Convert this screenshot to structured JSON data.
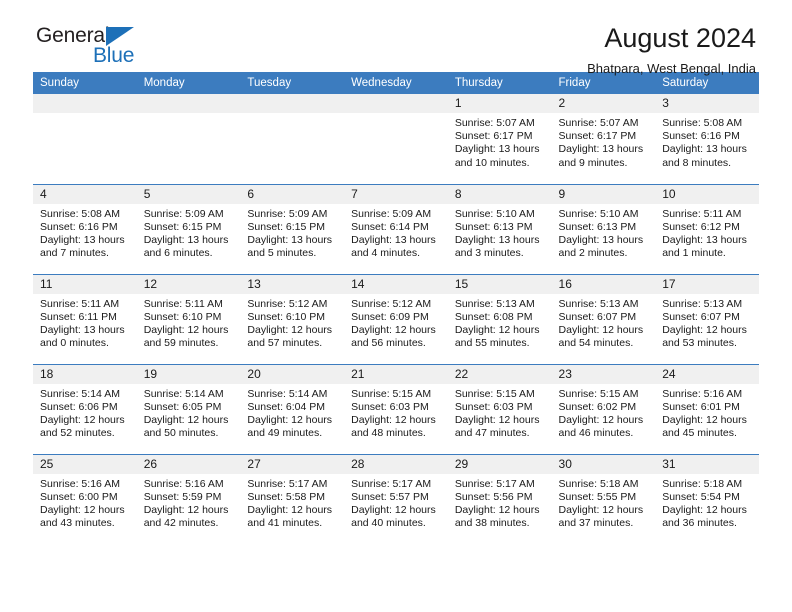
{
  "brand": {
    "word_one": "General",
    "word_two": "Blue",
    "flag_icon": "blue-triangle-flag",
    "accent_color": "#1d70b8"
  },
  "header": {
    "title": "August 2024",
    "subtitle": "Bhatpara, West Bengal, India"
  },
  "calendar": {
    "header_bg": "#3c7cbf",
    "daynum_bg": "#f0f0f0",
    "weekdays": [
      "Sunday",
      "Monday",
      "Tuesday",
      "Wednesday",
      "Thursday",
      "Friday",
      "Saturday"
    ],
    "labels": {
      "sunrise": "Sunrise:",
      "sunset": "Sunset:",
      "daylight": "Daylight:"
    },
    "weeks": [
      [
        {
          "day": "",
          "sunrise": "",
          "sunset": "",
          "daylight": ""
        },
        {
          "day": "",
          "sunrise": "",
          "sunset": "",
          "daylight": ""
        },
        {
          "day": "",
          "sunrise": "",
          "sunset": "",
          "daylight": ""
        },
        {
          "day": "",
          "sunrise": "",
          "sunset": "",
          "daylight": ""
        },
        {
          "day": "1",
          "sunrise": "Sunrise: 5:07 AM",
          "sunset": "Sunset: 6:17 PM",
          "daylight": "Daylight: 13 hours and 10 minutes."
        },
        {
          "day": "2",
          "sunrise": "Sunrise: 5:07 AM",
          "sunset": "Sunset: 6:17 PM",
          "daylight": "Daylight: 13 hours and 9 minutes."
        },
        {
          "day": "3",
          "sunrise": "Sunrise: 5:08 AM",
          "sunset": "Sunset: 6:16 PM",
          "daylight": "Daylight: 13 hours and 8 minutes."
        }
      ],
      [
        {
          "day": "4",
          "sunrise": "Sunrise: 5:08 AM",
          "sunset": "Sunset: 6:16 PM",
          "daylight": "Daylight: 13 hours and 7 minutes."
        },
        {
          "day": "5",
          "sunrise": "Sunrise: 5:09 AM",
          "sunset": "Sunset: 6:15 PM",
          "daylight": "Daylight: 13 hours and 6 minutes."
        },
        {
          "day": "6",
          "sunrise": "Sunrise: 5:09 AM",
          "sunset": "Sunset: 6:15 PM",
          "daylight": "Daylight: 13 hours and 5 minutes."
        },
        {
          "day": "7",
          "sunrise": "Sunrise: 5:09 AM",
          "sunset": "Sunset: 6:14 PM",
          "daylight": "Daylight: 13 hours and 4 minutes."
        },
        {
          "day": "8",
          "sunrise": "Sunrise: 5:10 AM",
          "sunset": "Sunset: 6:13 PM",
          "daylight": "Daylight: 13 hours and 3 minutes."
        },
        {
          "day": "9",
          "sunrise": "Sunrise: 5:10 AM",
          "sunset": "Sunset: 6:13 PM",
          "daylight": "Daylight: 13 hours and 2 minutes."
        },
        {
          "day": "10",
          "sunrise": "Sunrise: 5:11 AM",
          "sunset": "Sunset: 6:12 PM",
          "daylight": "Daylight: 13 hours and 1 minute."
        }
      ],
      [
        {
          "day": "11",
          "sunrise": "Sunrise: 5:11 AM",
          "sunset": "Sunset: 6:11 PM",
          "daylight": "Daylight: 13 hours and 0 minutes."
        },
        {
          "day": "12",
          "sunrise": "Sunrise: 5:11 AM",
          "sunset": "Sunset: 6:10 PM",
          "daylight": "Daylight: 12 hours and 59 minutes."
        },
        {
          "day": "13",
          "sunrise": "Sunrise: 5:12 AM",
          "sunset": "Sunset: 6:10 PM",
          "daylight": "Daylight: 12 hours and 57 minutes."
        },
        {
          "day": "14",
          "sunrise": "Sunrise: 5:12 AM",
          "sunset": "Sunset: 6:09 PM",
          "daylight": "Daylight: 12 hours and 56 minutes."
        },
        {
          "day": "15",
          "sunrise": "Sunrise: 5:13 AM",
          "sunset": "Sunset: 6:08 PM",
          "daylight": "Daylight: 12 hours and 55 minutes."
        },
        {
          "day": "16",
          "sunrise": "Sunrise: 5:13 AM",
          "sunset": "Sunset: 6:07 PM",
          "daylight": "Daylight: 12 hours and 54 minutes."
        },
        {
          "day": "17",
          "sunrise": "Sunrise: 5:13 AM",
          "sunset": "Sunset: 6:07 PM",
          "daylight": "Daylight: 12 hours and 53 minutes."
        }
      ],
      [
        {
          "day": "18",
          "sunrise": "Sunrise: 5:14 AM",
          "sunset": "Sunset: 6:06 PM",
          "daylight": "Daylight: 12 hours and 52 minutes."
        },
        {
          "day": "19",
          "sunrise": "Sunrise: 5:14 AM",
          "sunset": "Sunset: 6:05 PM",
          "daylight": "Daylight: 12 hours and 50 minutes."
        },
        {
          "day": "20",
          "sunrise": "Sunrise: 5:14 AM",
          "sunset": "Sunset: 6:04 PM",
          "daylight": "Daylight: 12 hours and 49 minutes."
        },
        {
          "day": "21",
          "sunrise": "Sunrise: 5:15 AM",
          "sunset": "Sunset: 6:03 PM",
          "daylight": "Daylight: 12 hours and 48 minutes."
        },
        {
          "day": "22",
          "sunrise": "Sunrise: 5:15 AM",
          "sunset": "Sunset: 6:03 PM",
          "daylight": "Daylight: 12 hours and 47 minutes."
        },
        {
          "day": "23",
          "sunrise": "Sunrise: 5:15 AM",
          "sunset": "Sunset: 6:02 PM",
          "daylight": "Daylight: 12 hours and 46 minutes."
        },
        {
          "day": "24",
          "sunrise": "Sunrise: 5:16 AM",
          "sunset": "Sunset: 6:01 PM",
          "daylight": "Daylight: 12 hours and 45 minutes."
        }
      ],
      [
        {
          "day": "25",
          "sunrise": "Sunrise: 5:16 AM",
          "sunset": "Sunset: 6:00 PM",
          "daylight": "Daylight: 12 hours and 43 minutes."
        },
        {
          "day": "26",
          "sunrise": "Sunrise: 5:16 AM",
          "sunset": "Sunset: 5:59 PM",
          "daylight": "Daylight: 12 hours and 42 minutes."
        },
        {
          "day": "27",
          "sunrise": "Sunrise: 5:17 AM",
          "sunset": "Sunset: 5:58 PM",
          "daylight": "Daylight: 12 hours and 41 minutes."
        },
        {
          "day": "28",
          "sunrise": "Sunrise: 5:17 AM",
          "sunset": "Sunset: 5:57 PM",
          "daylight": "Daylight: 12 hours and 40 minutes."
        },
        {
          "day": "29",
          "sunrise": "Sunrise: 5:17 AM",
          "sunset": "Sunset: 5:56 PM",
          "daylight": "Daylight: 12 hours and 38 minutes."
        },
        {
          "day": "30",
          "sunrise": "Sunrise: 5:18 AM",
          "sunset": "Sunset: 5:55 PM",
          "daylight": "Daylight: 12 hours and 37 minutes."
        },
        {
          "day": "31",
          "sunrise": "Sunrise: 5:18 AM",
          "sunset": "Sunset: 5:54 PM",
          "daylight": "Daylight: 12 hours and 36 minutes."
        }
      ]
    ]
  }
}
